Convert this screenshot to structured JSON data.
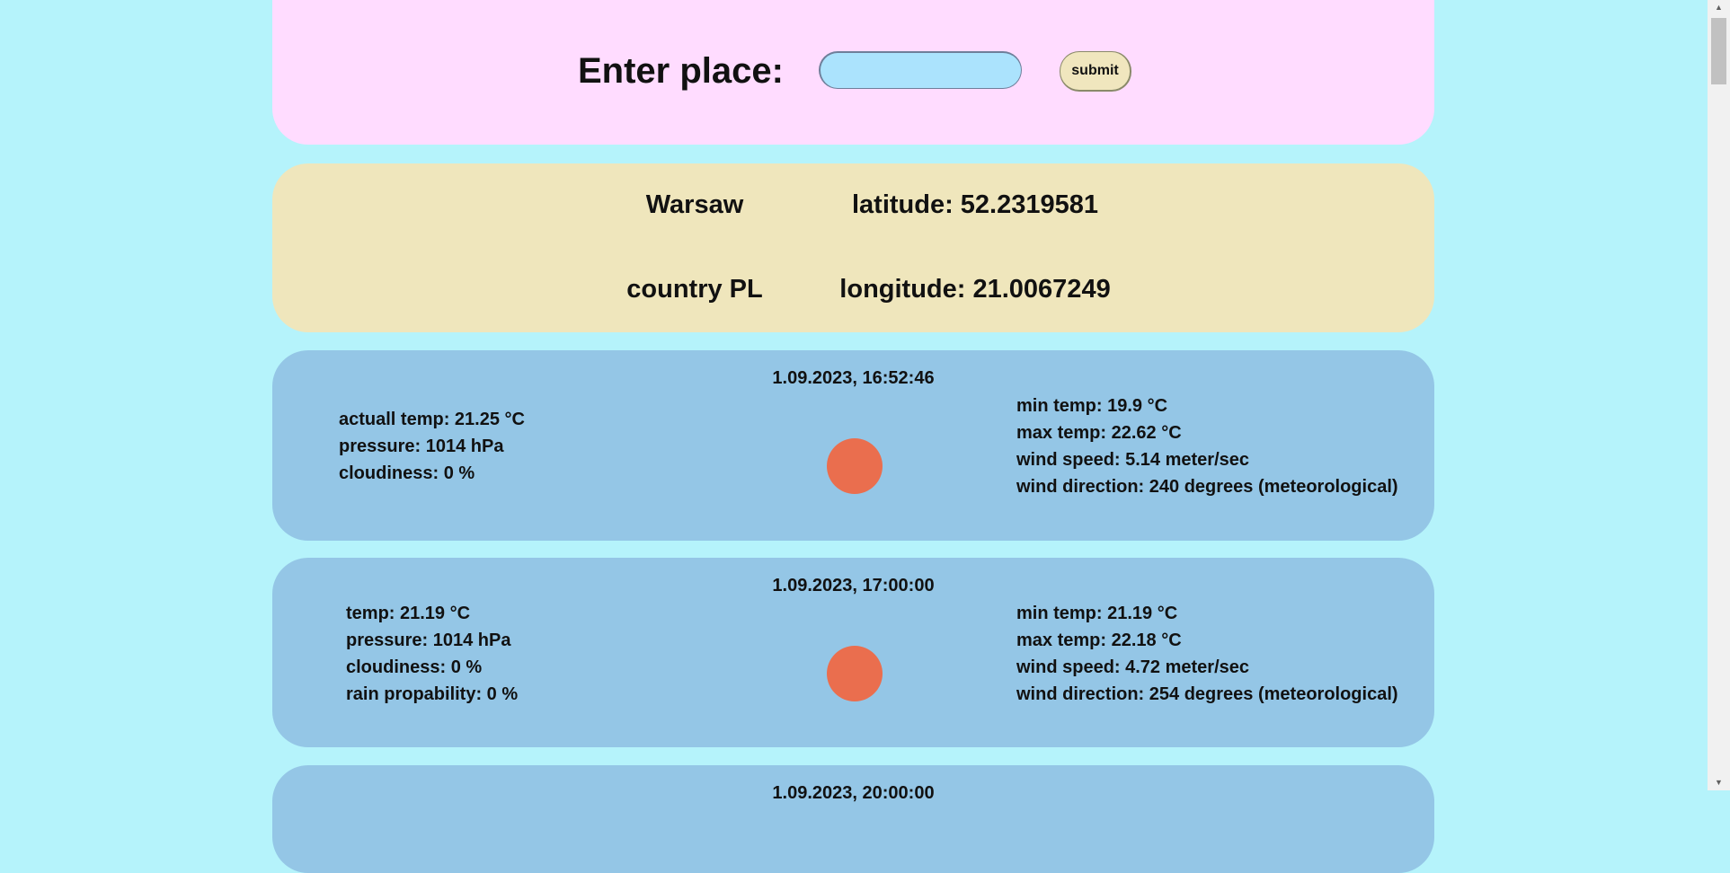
{
  "search": {
    "label": "Enter place:",
    "input_value": "",
    "input_placeholder": "",
    "submit_label": "submit"
  },
  "location": {
    "city": "Warsaw",
    "latitude": "latitude: 52.2319581",
    "country": "country PL",
    "longitude": "longitude: 21.0067249"
  },
  "weather": [
    {
      "timestamp": "1.09.2023, 16:52:46",
      "left": [
        "actuall temp: 21.25 °C",
        "pressure: 1014 hPa",
        "cloudiness: 0 %"
      ],
      "right": [
        "min temp: 19.9 °C",
        "max temp: 22.62 °C",
        "wind speed: 5.14 meter/sec",
        "wind direction: 240 degrees (meteorological)"
      ],
      "icon": "sun-icon"
    },
    {
      "timestamp": "1.09.2023, 17:00:00",
      "left": [
        "temp: 21.19 °C",
        "pressure: 1014 hPa",
        "cloudiness: 0 %",
        "rain propability: 0 %"
      ],
      "right": [
        "min temp: 21.19 °C",
        "max temp: 22.18 °C",
        "wind speed: 4.72 meter/sec",
        "wind direction: 254 degrees (meteorological)"
      ],
      "icon": "sun-icon"
    },
    {
      "timestamp": "1.09.2023, 20:00:00"
    }
  ],
  "colors": {
    "background": "#b5f3fb",
    "search_panel": "#ffdcff",
    "location_panel": "#efe6bc",
    "weather_panel": "#94c6e6",
    "sun": "#ea6e4e"
  }
}
